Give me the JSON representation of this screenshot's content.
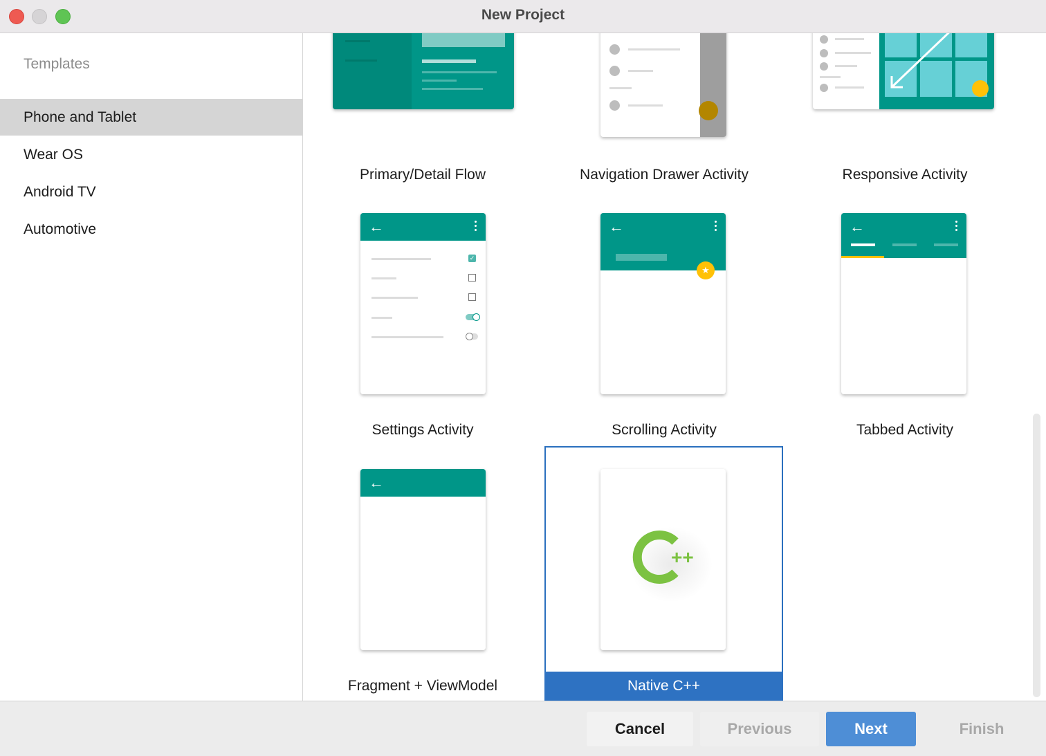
{
  "window": {
    "title": "New Project"
  },
  "sidebar": {
    "header": "Templates",
    "items": [
      {
        "label": "Phone and Tablet",
        "selected": true
      },
      {
        "label": "Wear OS"
      },
      {
        "label": "Android TV"
      },
      {
        "label": "Automotive"
      }
    ]
  },
  "templates": [
    {
      "label": "Primary/Detail Flow"
    },
    {
      "label": "Navigation Drawer Activity"
    },
    {
      "label": "Responsive Activity"
    },
    {
      "label": "Settings Activity"
    },
    {
      "label": "Scrolling Activity"
    },
    {
      "label": "Tabbed Activity"
    },
    {
      "label": "Fragment + ViewModel"
    },
    {
      "label": "Native C++",
      "selected": true,
      "logo_text": "C++"
    }
  ],
  "footer": {
    "cancel": "Cancel",
    "previous": "Previous",
    "next": "Next",
    "finish": "Finish"
  },
  "colors": {
    "teal": "#009688",
    "accent": "#ffc107",
    "selection": "#2e72c2",
    "cpp_green": "#7cc242"
  }
}
